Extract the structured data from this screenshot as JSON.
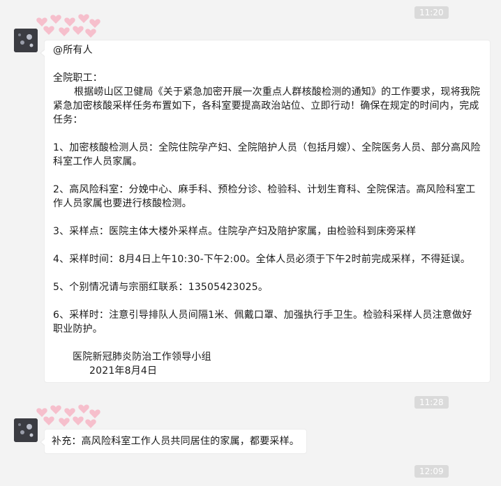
{
  "timestamps": [
    "11:20",
    "11:28",
    "12:09"
  ],
  "messages": [
    {
      "mention": "@所有人",
      "greeting": "全院职工：",
      "intro": "根据崂山区卫健局《关于紧急加密开展一次重点人群核酸检测的通知》的工作要求，现将我院紧急加密核酸采样任务布置如下，各科室要提高政治站位、立即行动！确保在规定的时间内，完成任务：",
      "items": [
        "1、加密核酸检测人员：全院住院孕产妇、全院陪护人员（包括月嫂）、全院医务人员、部分高风险科室工作人员家属。",
        "2、高风险科室：分娩中心、麻手科、预检分诊、检验科、计划生育科、全院保洁。高风险科室工作人员家属也要进行核酸检测。",
        "3、采样点：医院主体大楼外采样点。住院孕产妇及陪护家属，由检验科到床旁采样",
        "4、采样时间：8月4日上午10:30-下午2:00。全体人员必须于下午2时前完成采样，不得延误。",
        "5、个别情况请与宗丽红联系：13505423025。",
        "6、采样时：注意引导排队人员间隔1米、佩戴口罩、加强执行手卫生。检验科采样人员注意做好职业防护。"
      ],
      "signature": "医院新冠肺炎防治工作领导小组",
      "date": "2021年8月4日"
    },
    {
      "text": "补充：高风险科室工作人员共同居住的家属，都要采样。"
    }
  ],
  "colors": {
    "background": "#f3f3f3",
    "bubble": "#ffffff",
    "time_pill": "#dadada",
    "heart_pink": "#f7b6c6"
  }
}
